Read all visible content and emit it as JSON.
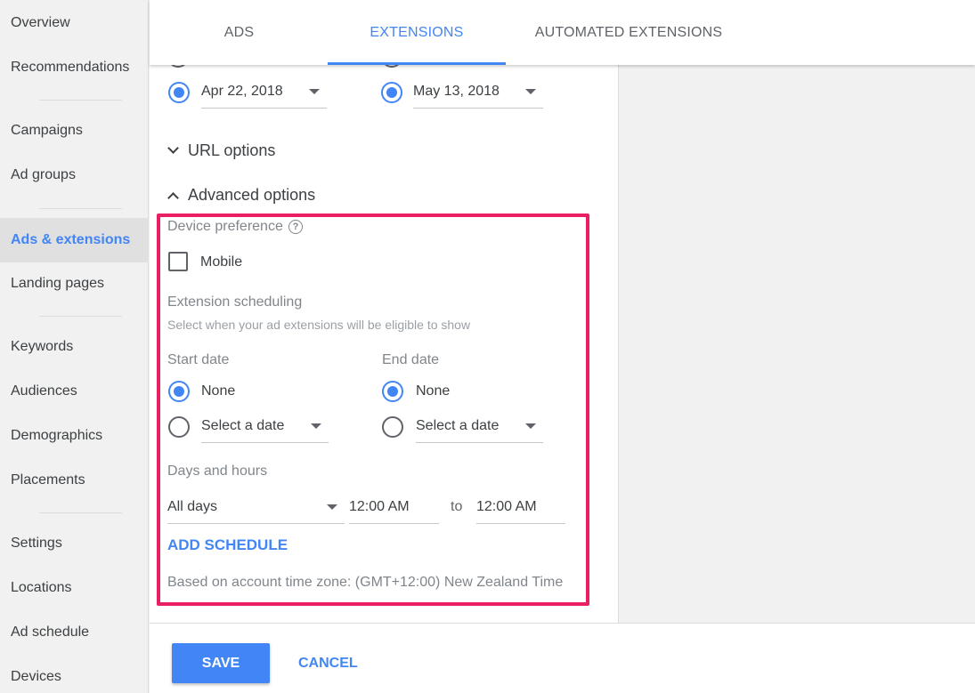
{
  "sidebar": {
    "items": [
      {
        "label": "Overview"
      },
      {
        "label": "Recommendations"
      },
      {
        "label": "Campaigns"
      },
      {
        "label": "Ad groups"
      },
      {
        "label": "Ads & extensions"
      },
      {
        "label": "Landing pages"
      },
      {
        "label": "Keywords"
      },
      {
        "label": "Audiences"
      },
      {
        "label": "Demographics"
      },
      {
        "label": "Placements"
      },
      {
        "label": "Settings"
      },
      {
        "label": "Locations"
      },
      {
        "label": "Ad schedule"
      },
      {
        "label": "Devices"
      }
    ],
    "active_item": "Ads & extensions"
  },
  "tabs": [
    {
      "label": "ADS"
    },
    {
      "label": "EXTENSIONS"
    },
    {
      "label": "AUTOMATED EXTENSIONS"
    }
  ],
  "active_tab": "EXTENSIONS",
  "top_dates": {
    "start_value": "Apr 22, 2018",
    "end_value": "May 13, 2018"
  },
  "url_options": {
    "label": "URL options"
  },
  "advanced_options": {
    "label": "Advanced options"
  },
  "device_preference": {
    "label": "Device preference",
    "help_glyph": "?",
    "mobile_label": "Mobile",
    "mobile_checked": false
  },
  "extension_scheduling": {
    "title": "Extension scheduling",
    "description": "Select when your ad extensions will be eligible to show",
    "start_date": {
      "label": "Start date",
      "none_label": "None",
      "select_label": "Select a date",
      "selected": "None"
    },
    "end_date": {
      "label": "End date",
      "none_label": "None",
      "select_label": "Select a date",
      "selected": "None"
    },
    "days_hours": {
      "label": "Days and hours",
      "days_value": "All days",
      "from_time": "12:00 AM",
      "to_label": "to",
      "to_time": "12:00 AM"
    },
    "add_schedule_label": "ADD SCHEDULE",
    "timezone_note": "Based on account time zone: (GMT+12:00) New Zealand Time"
  },
  "footer": {
    "save_label": "SAVE",
    "cancel_label": "CANCEL"
  },
  "colors": {
    "accent": "#4285f4",
    "highlight_border": "#e91e63"
  }
}
